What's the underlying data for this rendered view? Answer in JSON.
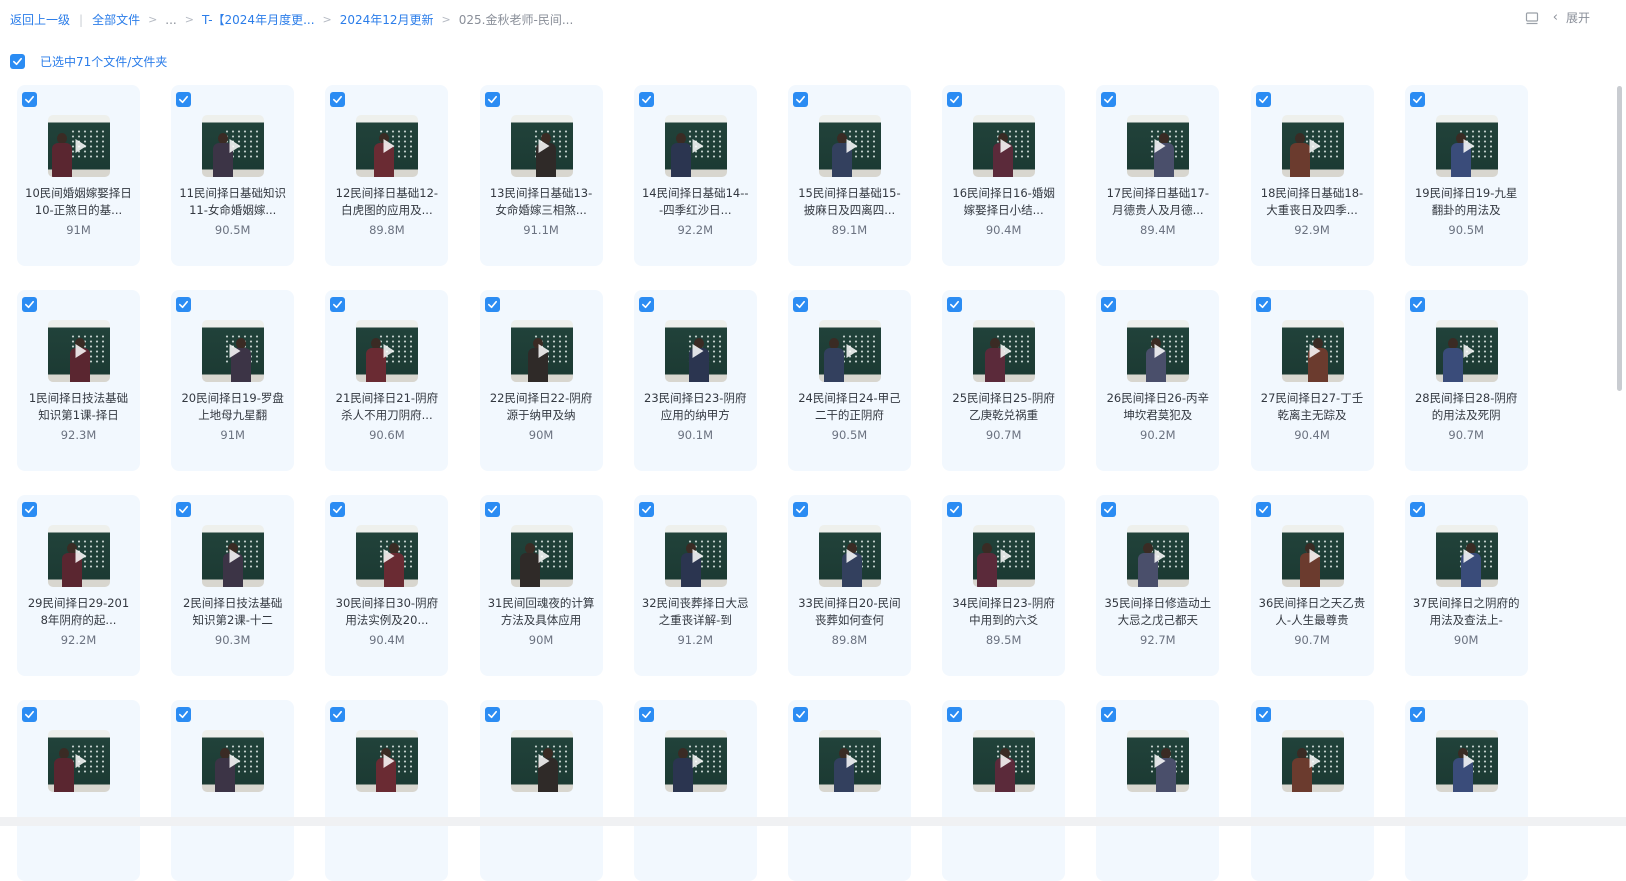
{
  "breadcrumb": {
    "back_label": "返回上一级",
    "root_label": "全部文件",
    "ellipsis": "...",
    "items": [
      "T-【2024年月度更...",
      "2024年12月更新",
      "025.金秋老师-民间..."
    ]
  },
  "header": {
    "expand_label": "展开"
  },
  "selection": {
    "label": "已选中71个文件/文件夹"
  },
  "colors": {
    "accent": "#2b7de9",
    "card_bg": "#f2f8fe",
    "checkbox": "#2b8cf3"
  },
  "files": [
    {
      "name": "10民间婚姻嫁娶择日10-正煞日的基...",
      "size": "91M"
    },
    {
      "name": "11民间择日基础知识11-女命婚姻嫁...",
      "size": "90.5M"
    },
    {
      "name": "12民间择日基础12-白虎图的应用及...",
      "size": "89.8M"
    },
    {
      "name": "13民间择日基础13-女命婚嫁三相煞...",
      "size": "91.1M"
    },
    {
      "name": "14民间择日基础14---四季红沙日...",
      "size": "92.2M"
    },
    {
      "name": "15民间择日基础15-披麻日及四离四...",
      "size": "89.1M"
    },
    {
      "name": "16民间择日16-婚姻嫁娶择日小结...",
      "size": "90.4M"
    },
    {
      "name": "17民间择日基础17-月德贵人及月德...",
      "size": "89.4M"
    },
    {
      "name": "18民间择日基础18-大重丧日及四季...",
      "size": "92.9M"
    },
    {
      "name": "19民间择日19-九星翻卦的用法及",
      "size": "90.5M"
    },
    {
      "name": "1民间择日技法基础知识第1课-择日",
      "size": "92.3M"
    },
    {
      "name": "20民间择日19-罗盘上地母九星翻",
      "size": "91M"
    },
    {
      "name": "21民间择日21-阴府杀人不用刀阴府...",
      "size": "90.6M"
    },
    {
      "name": "22民间择日22-阴府源于纳甲及纳",
      "size": "90M"
    },
    {
      "name": "23民间择日23-阴府应用的纳甲方",
      "size": "90.1M"
    },
    {
      "name": "24民间择日24-甲己二干的正阴府",
      "size": "90.5M"
    },
    {
      "name": "25民间择日25-阴府乙庚乾兑祸重",
      "size": "90.7M"
    },
    {
      "name": "26民间择日26-丙辛坤坎君莫犯及",
      "size": "90.2M"
    },
    {
      "name": "27民间择日27-丁壬乾离主无踪及",
      "size": "90.4M"
    },
    {
      "name": "28民间择日28-阴府的用法及死阴",
      "size": "90.7M"
    },
    {
      "name": "29民间择日29-2018年阴府的起...",
      "size": "92.2M"
    },
    {
      "name": "2民间择日技法基础知识第2课-十二",
      "size": "90.3M"
    },
    {
      "name": "30民间择日30-阴府用法实例及20...",
      "size": "90.4M"
    },
    {
      "name": "31民间回魂夜的计算方法及具体应用",
      "size": "90M"
    },
    {
      "name": "32民间丧葬择日大忌之重丧详解-到",
      "size": "91.2M"
    },
    {
      "name": "33民间择日20-民间丧葬如何查何",
      "size": "89.8M"
    },
    {
      "name": "34民间择日23-阴府中用到的六爻",
      "size": "89.5M"
    },
    {
      "name": "35民间择日修造动土大忌之戊己都天",
      "size": "92.7M"
    },
    {
      "name": "36民间择日之天乙贵人-人生最尊贵",
      "size": "90.7M"
    },
    {
      "name": "37民间择日之阴府的用法及查法上-",
      "size": "90M"
    },
    {
      "name": "",
      "size": ""
    },
    {
      "name": "",
      "size": ""
    },
    {
      "name": "",
      "size": ""
    },
    {
      "name": "",
      "size": ""
    },
    {
      "name": "",
      "size": ""
    },
    {
      "name": "",
      "size": ""
    },
    {
      "name": "",
      "size": ""
    },
    {
      "name": "",
      "size": ""
    },
    {
      "name": "",
      "size": ""
    },
    {
      "name": "",
      "size": ""
    }
  ]
}
